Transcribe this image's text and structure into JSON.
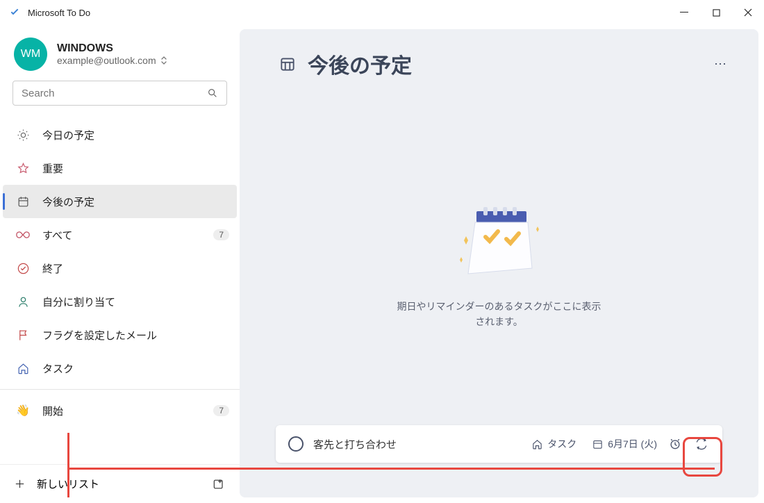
{
  "app": {
    "title": "Microsoft To Do"
  },
  "account": {
    "initials": "WM",
    "name": "WINDOWS",
    "email": "example@outlook.com"
  },
  "search": {
    "placeholder": "Search"
  },
  "nav": {
    "items": [
      {
        "label": "今日の予定",
        "icon": "sun-icon",
        "badge": null,
        "selected": false
      },
      {
        "label": "重要",
        "icon": "star-icon",
        "badge": null,
        "selected": false
      },
      {
        "label": "今後の予定",
        "icon": "calendar-icon",
        "badge": null,
        "selected": true
      },
      {
        "label": "すべて",
        "icon": "infinity-icon",
        "badge": "7",
        "selected": false
      },
      {
        "label": "終了",
        "icon": "check-circle-icon",
        "badge": null,
        "selected": false
      },
      {
        "label": "自分に割り当て",
        "icon": "person-icon",
        "badge": null,
        "selected": false
      },
      {
        "label": "フラグを設定したメール",
        "icon": "flag-icon",
        "badge": null,
        "selected": false
      },
      {
        "label": "タスク",
        "icon": "home-icon",
        "badge": null,
        "selected": false
      }
    ],
    "extra": {
      "label": "開始",
      "badge": "7",
      "icon": "wave-icon"
    }
  },
  "newlist": {
    "label": "新しいリスト"
  },
  "main": {
    "title": "今後の予定",
    "empty_message": "期日やリマインダーのあるタスクがここに表示\nされます。"
  },
  "task_input": {
    "title": "客先と打ち合わせ",
    "list_chip": "タスク",
    "date_chip": "6月7日 (火)"
  }
}
